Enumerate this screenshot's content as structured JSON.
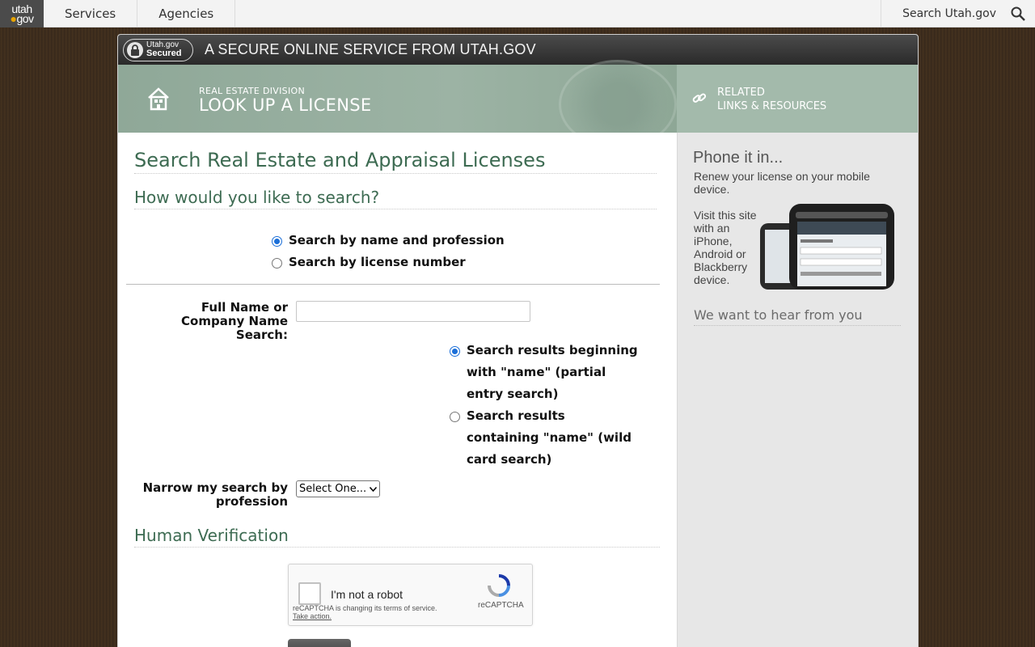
{
  "topbar": {
    "logo_top": "utah",
    "logo_bottom": "gov",
    "nav": [
      "Services",
      "Agencies"
    ],
    "search_label": "Search Utah.gov"
  },
  "secure": {
    "badge_line1": "Utah.gov",
    "badge_line2": "Secured",
    "title": "A SECURE ONLINE SERVICE FROM UTAH.GOV"
  },
  "banner": {
    "division": "REAL ESTATE DIVISION",
    "title": "LOOK UP A LICENSE",
    "related_line1": "RELATED",
    "related_line2": "LINKS & RESOURCES"
  },
  "main": {
    "title": "Search Real Estate and Appraisal Licenses",
    "how_heading": "How would you like to search?",
    "search_type": [
      {
        "label": "Search by name and profession",
        "selected": true
      },
      {
        "label": "Search by license number",
        "selected": false
      }
    ],
    "name_label_1": "Full Name or",
    "name_label_2": "Company Name",
    "name_label_3": "Search:",
    "name_value": "",
    "match_mode": [
      {
        "line1": "Search results beginning",
        "line2": "with \"name\" (partial",
        "line3": "entry search)",
        "selected": true
      },
      {
        "line1": "Search results",
        "line2": "containing \"name\" (wild",
        "line3": "card search)",
        "selected": false
      }
    ],
    "profession_label_1": "Narrow my search by",
    "profession_label_2": "profession",
    "profession_selected": "Select One...",
    "verification_heading": "Human Verification",
    "recaptcha": {
      "label": "I'm not a robot",
      "terms": "reCAPTCHA is changing its terms of service.",
      "take_action": "Take action.",
      "brand": "reCAPTCHA"
    }
  },
  "sidebar": {
    "phone_title": "Phone it in...",
    "renew_text": "Renew your license on your mobile device.",
    "visit_text": "Visit this site with an iPhone, Android or Blackberry device.",
    "feedback_heading": "We want to hear from you"
  },
  "colors": {
    "heading_green": "#3d6b52",
    "banner_green": "#9cb3a4",
    "radio_blue": "#1b6fd8"
  }
}
